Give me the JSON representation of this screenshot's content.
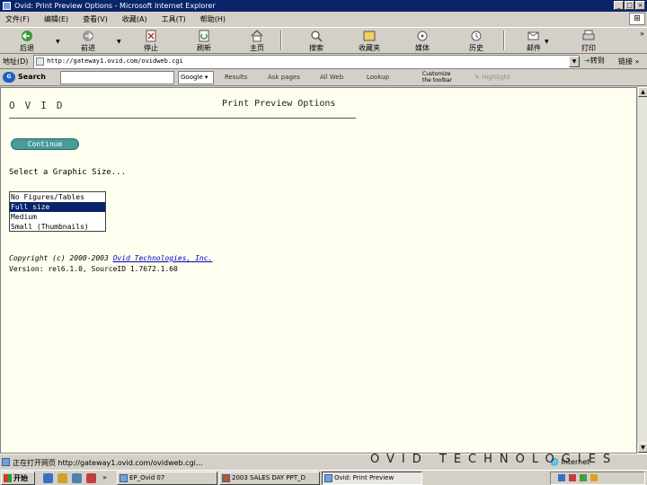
{
  "window": {
    "title": "Ovid: Print Preview Options - Microsoft Internet Explorer",
    "controls": [
      "_",
      "□",
      "×"
    ]
  },
  "menu": [
    "文件(F)",
    "编辑(E)",
    "查看(V)",
    "收藏(A)",
    "工具(T)",
    "帮助(H)"
  ],
  "toolbar": {
    "back": "后退",
    "forward": "前进",
    "stop": "停止",
    "refresh": "刷新",
    "home": "主页",
    "search": "搜索",
    "favorites": "收藏夹",
    "media": "媒体",
    "history": "历史",
    "mail": "邮件",
    "print": "打印",
    "chevron": "»"
  },
  "address": {
    "label": "地址(D)",
    "url": "http://gateway1.ovid.com/ovidweb.cgi",
    "go": "转到",
    "links": "链接 »"
  },
  "googlebar": {
    "search_label": "Search",
    "engine": "Google",
    "items": [
      "Results",
      "Ask pages",
      "All Web",
      "Lookup"
    ],
    "customize": [
      "Customize",
      "the toolbar"
    ],
    "highlight": "Highlight"
  },
  "page": {
    "logo": "OVID",
    "title": "Print Preview Options",
    "continue_label": "Continue",
    "select_label": "Select a Graphic Size...",
    "size_options": [
      "No Figures/Tables",
      "Full size",
      "Medium",
      "Small (Thumbnails)"
    ],
    "selected_size": "Full size",
    "copyright_prefix": "Copyright (c) 2000-2003 ",
    "copyright_link": "Ovid Technologies, Inc.",
    "version": "Version: rel6.1.0, SourceID 1.7672.1.60"
  },
  "status": {
    "text": "正在打开网页 http://gateway1.ovid.com/ovidweb.cgi...",
    "zone": "Internet"
  },
  "watermark": "OVID TECHNOLOGIES",
  "taskbar": {
    "start": "开始",
    "chevron": "»",
    "tasks": [
      "EP_Ovid 07",
      "2003 SALES DAY PPT_D",
      "Ovid: Print Preview"
    ]
  }
}
